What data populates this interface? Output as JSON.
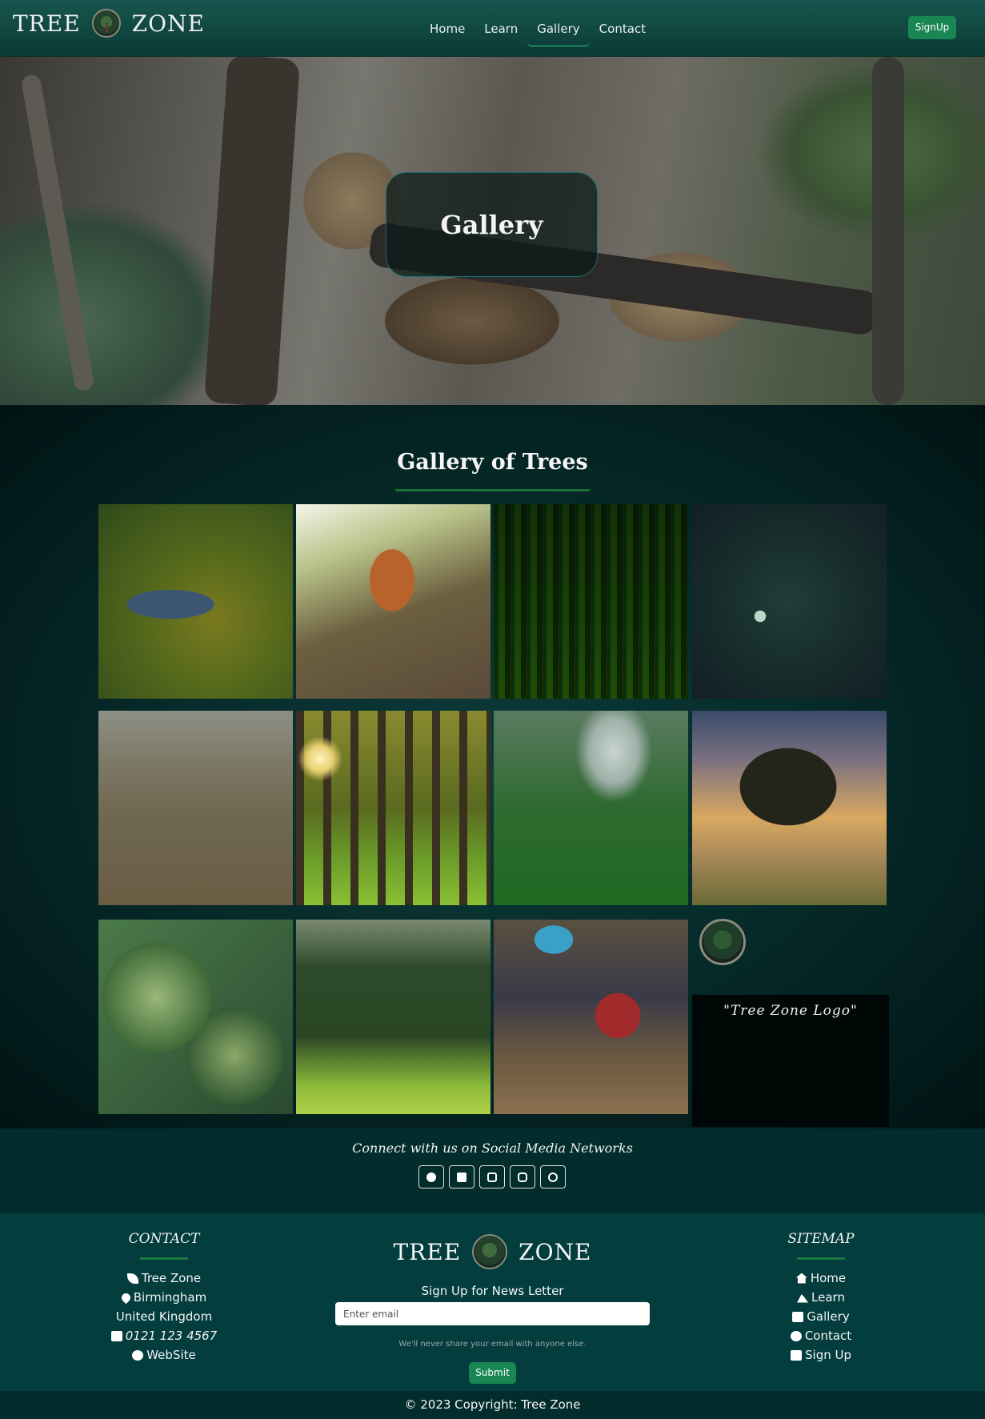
{
  "navbar": {
    "brand_left": "TREE",
    "brand_right": "ZONE",
    "links": [
      {
        "label": "Home"
      },
      {
        "label": "Learn"
      },
      {
        "label": "Gallery"
      },
      {
        "label": "Contact"
      }
    ],
    "active_link": "Gallery",
    "signup_label": "SignUp"
  },
  "hero": {
    "title": "Gallery"
  },
  "gallery": {
    "title": "Gallery of Trees",
    "logo_caption": "\"Tree Zone Logo\""
  },
  "social": {
    "title": "Connect with us on Social Media Networks",
    "icons": [
      "facebook-icon",
      "twitter-icon",
      "youtube-icon",
      "instagram-icon",
      "whatsapp-icon"
    ]
  },
  "footer": {
    "contact": {
      "heading": "CONTACT",
      "name": "Tree Zone",
      "city": "Birmingham",
      "country": "United Kingdom",
      "phone": "0121 123 4567",
      "website": "WebSite"
    },
    "brand_left": "TREE",
    "brand_right": "ZONE",
    "newsletter": {
      "title": "Sign Up for News Letter",
      "placeholder": "Enter email",
      "help": "We'll never share your email with anyone else.",
      "submit_label": "Submit"
    },
    "sitemap": {
      "heading": "SITEMAP",
      "items": [
        {
          "label": "Home"
        },
        {
          "label": "Learn"
        },
        {
          "label": "Gallery"
        },
        {
          "label": "Contact"
        },
        {
          "label": "Sign Up"
        }
      ]
    },
    "copyright": "© 2023 Copyright: Tree Zone"
  },
  "colors": {
    "accent": "#198754",
    "navbar": "#0c3a36",
    "footer": "#033d3d"
  }
}
